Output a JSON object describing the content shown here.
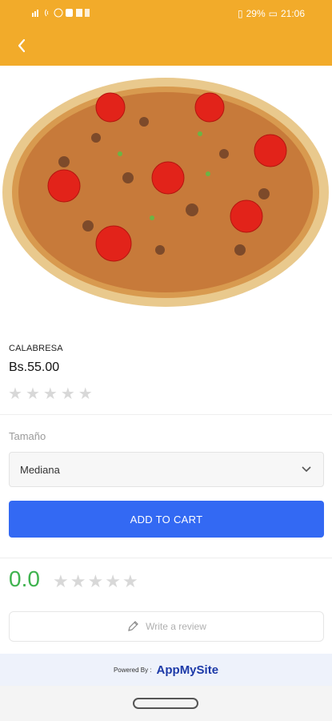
{
  "status_bar": {
    "battery": "29%",
    "time": "21:06"
  },
  "header": {
    "back_icon": "chevron-left-icon",
    "color": "#f2ab2a"
  },
  "product": {
    "image_icon": "pizza-image",
    "name": "CALABRESA",
    "price": "Bs.55.00",
    "stars": [
      "★",
      "★",
      "★",
      "★",
      "★"
    ],
    "star_rating": 0
  },
  "size": {
    "label": "Tamaño",
    "selected": "Mediana"
  },
  "cart": {
    "button_label": "ADD TO CART",
    "color": "#3369f3"
  },
  "reviews": {
    "average": "0.0",
    "stars": [
      "★",
      "★",
      "★",
      "★",
      "★"
    ],
    "write_review_label": "Write a review",
    "rating_color": "#3fb34f"
  },
  "footer": {
    "powered_by": "Powered By :",
    "brand": "AppMySite"
  }
}
